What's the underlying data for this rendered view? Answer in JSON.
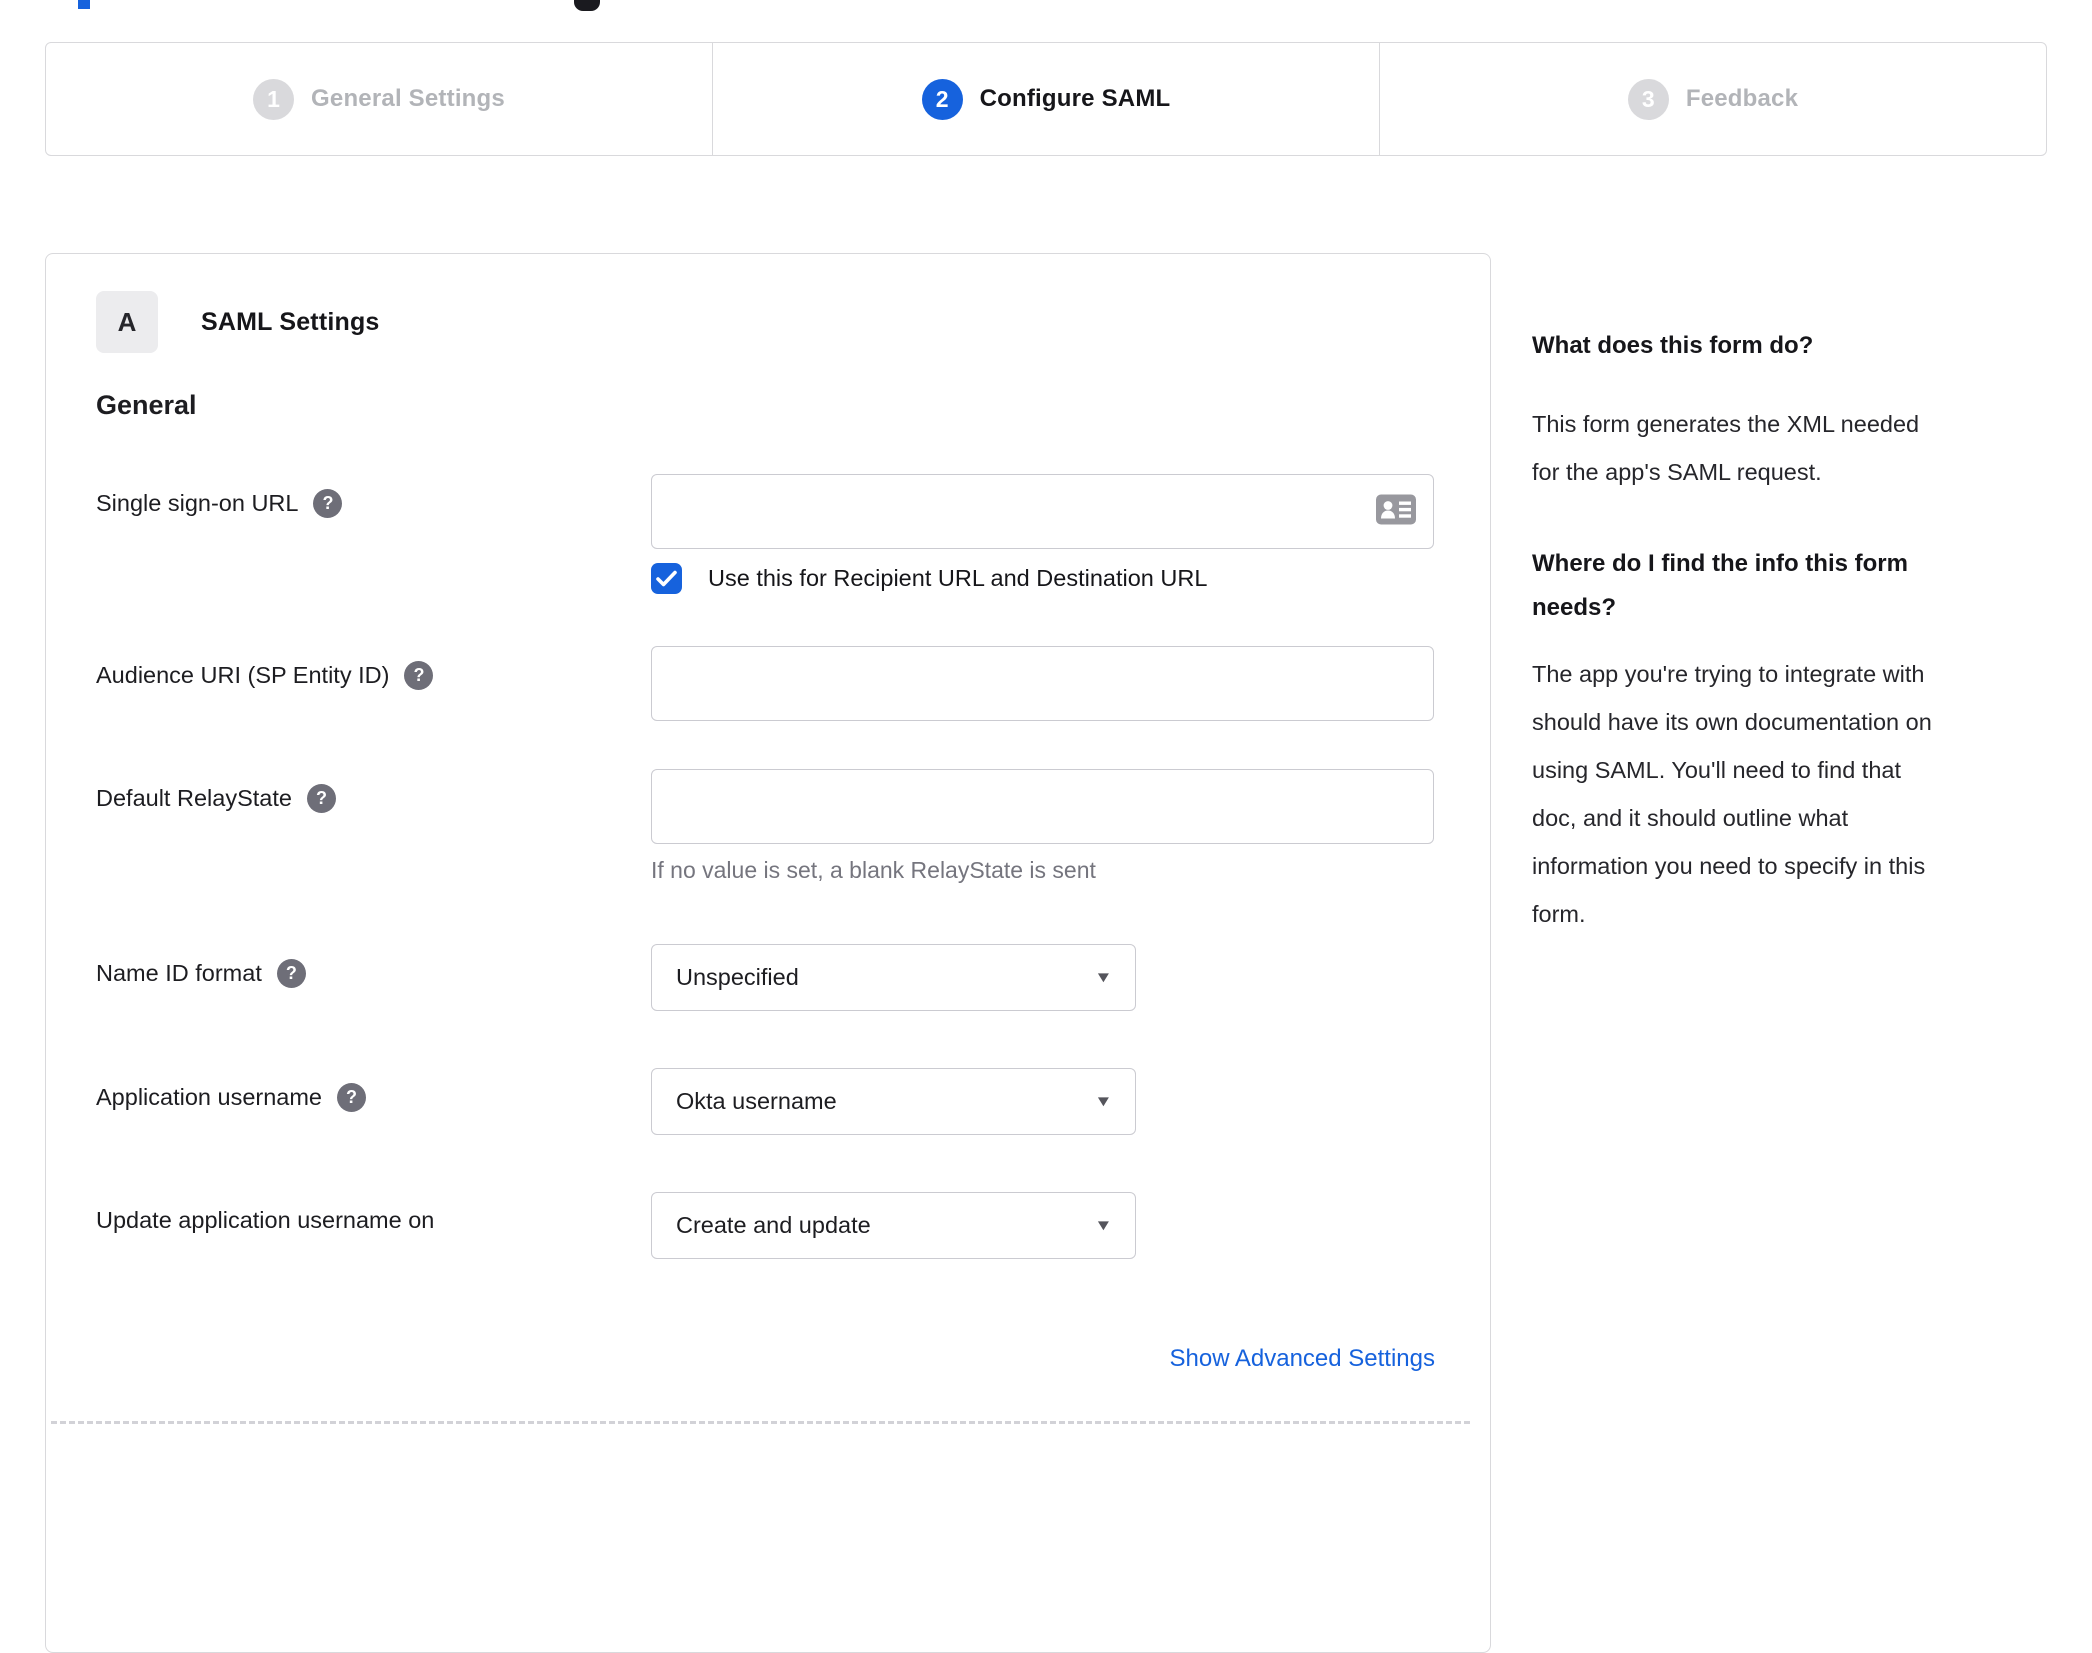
{
  "colors": {
    "accent": "#1662dd",
    "inactive_circle": "#d9d9dc",
    "inactive_text": "#b2b4b8",
    "text_dark": "#1d1d21",
    "muted_text": "#75757e",
    "border": "#d9d9dc",
    "input_border": "#cbcbd1",
    "help_bg": "#6e6e78"
  },
  "icons": {
    "help_glyph": "?",
    "dropdown_glyph": "▼"
  },
  "stepper": {
    "steps": [
      {
        "number": "1",
        "label": "General Settings"
      },
      {
        "number": "2",
        "label": "Configure SAML"
      },
      {
        "number": "3",
        "label": "Feedback"
      }
    ]
  },
  "panel": {
    "section_badge": "A",
    "section_title": "SAML Settings",
    "group_title": "General",
    "fields": {
      "sso": {
        "label": "Single sign-on URL",
        "value": "",
        "checkbox_label": "Use this for Recipient URL and Destination URL",
        "checkbox_checked": true
      },
      "audience": {
        "label": "Audience URI (SP Entity ID)",
        "value": ""
      },
      "relay": {
        "label": "Default RelayState",
        "value": "",
        "helper": "If no value is set, a blank RelayState is sent"
      },
      "nameid": {
        "label": "Name ID format",
        "value": "Unspecified"
      },
      "appuser": {
        "label": "Application username",
        "value": "Okta username"
      },
      "updateuser": {
        "label": "Update application username on",
        "value": "Create and update"
      }
    },
    "advanced_link": "Show Advanced Settings"
  },
  "sidebar": {
    "q1": "What does this form do?",
    "a1_lines": [
      "This form generates the XML needed",
      "for the app's SAML request."
    ],
    "q2_lines": [
      "Where do I find the info this form",
      "needs?"
    ],
    "a2_lines": [
      "The app you're trying to integrate with",
      "should have its own documentation on",
      "using SAML. You'll need to find that",
      "doc, and it should outline what",
      "information you need to specify in this",
      "form."
    ]
  }
}
